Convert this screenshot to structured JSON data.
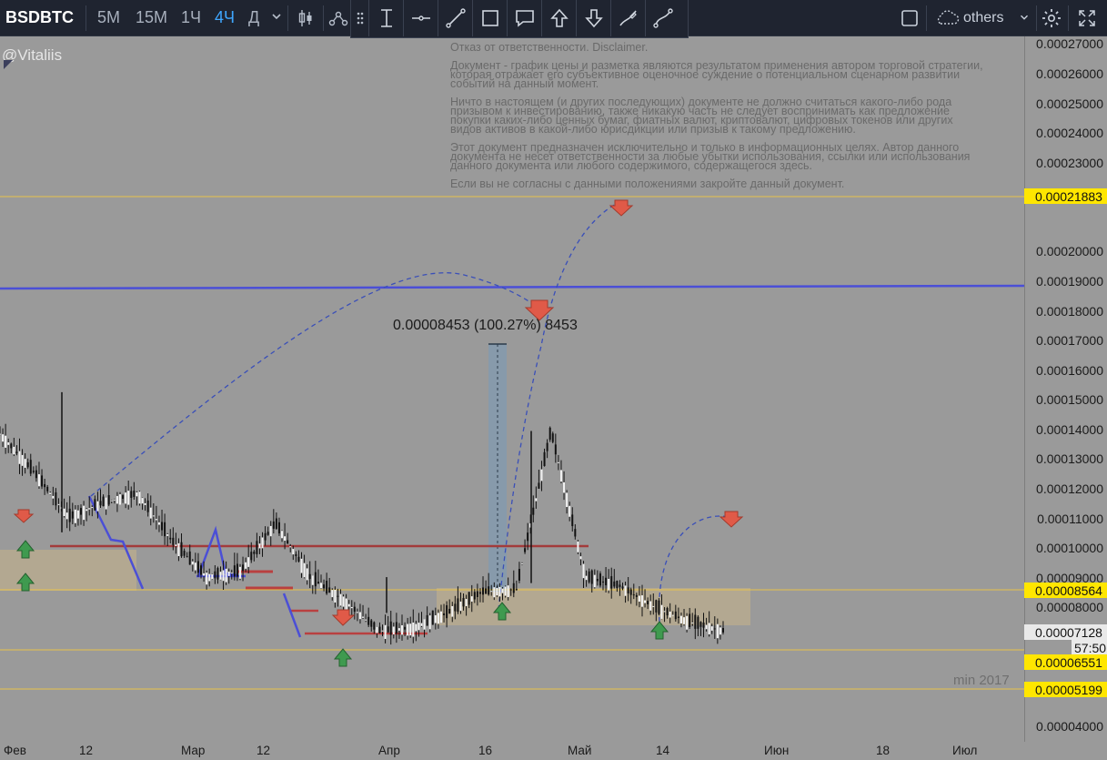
{
  "toolbar": {
    "symbol": "BSDBTC",
    "timeframes": [
      {
        "label": "5M",
        "active": false
      },
      {
        "label": "15M",
        "active": false
      },
      {
        "label": "1Ч",
        "active": false
      },
      {
        "label": "4Ч",
        "active": true
      },
      {
        "label": "Д",
        "active": false
      }
    ],
    "others_label": "others",
    "accent": "#3fa7ff"
  },
  "chart": {
    "author": "@Vitaliis",
    "disclaimer": [
      "Отказ от ответственности. Disclaimer.",
      "Документ - график цены и разметка являются результатом применения автором торговой стратегии, которая отражает его субъективное оценочное суждение о потенциальном сценарном развитии событий на данный момент.",
      "Ничто в настоящем (и других последующих) документе не должно считаться какого-либо рода призывом к инвестированию, также никакую часть не следует воспринимать как предложение покупки каких-либо ценных бумаг, фиатных валют, криптовалют, цифровых токенов или других видов активов в какой-либо юрисдикции или призыв к такому предложению.",
      "Этот документ предназначен исключительно и только в информационных целях. Автор данного документа не несет ответственности за любые убытки использования, ссылки или использования данного документа или любого содержимого, содержащегося здесь.",
      "Если вы не согласны с данными положениями закройте данный документ."
    ],
    "measure_label": "0.00008453 (100.27%) 8453",
    "min_label": "min 2017"
  },
  "price_axis": {
    "ticks": [
      "0.00027000",
      "0.00026000",
      "0.00025000",
      "0.00024000",
      "0.00023000",
      "0.00020000",
      "0.00019000",
      "0.00018000",
      "0.00017000",
      "0.00016000",
      "0.00015000",
      "0.00014000",
      "0.00013000",
      "0.00012000",
      "0.00011000",
      "0.00010000",
      "0.00009000",
      "0.00008000",
      "0.00004000"
    ],
    "badges": {
      "level_high": "0.00021883",
      "level_mid": "0.00008564",
      "current": "0.00007128",
      "timer": "57:50",
      "level_low": "0.00006551",
      "level_min": "0.00005199"
    }
  },
  "time_axis": {
    "ticks": [
      "Фев",
      "12",
      "Мар",
      "12",
      "Апр",
      "16",
      "Май",
      "14",
      "Июн",
      "18",
      "Июл"
    ]
  },
  "chart_data": {
    "type": "candlestick",
    "symbol": "BSDBTC",
    "timeframe": "4Ч",
    "ylim": [
      4e-05,
      0.00027
    ],
    "horizontal_levels": [
      0.00021883,
      8.564e-05,
      6.551e-05,
      5.199e-05
    ],
    "resistance_line": 0.000188,
    "red_level": 0.0001,
    "current_price": 7.128e-05,
    "measurement": {
      "from": 8.453e-05,
      "change_pct": 100.27,
      "to": 0.00016906
    },
    "price_path": [
      [
        "Фев",
        0.000138
      ],
      [
        "Фев",
        0.000125
      ],
      [
        "Фев",
        0.00011
      ],
      [
        "12",
        0.000115
      ],
      [
        "12",
        0.000118
      ],
      [
        "12",
        0.000102
      ],
      [
        "Мар",
        9e-05
      ],
      [
        "Мар",
        9.2e-05
      ],
      [
        "Мар",
        0.000108
      ],
      [
        "12",
        9e-05
      ],
      [
        "12",
        8.2e-05
      ],
      [
        "12",
        7.2e-05
      ],
      [
        "Апр",
        7.3e-05
      ],
      [
        "Апр",
        7.8e-05
      ],
      [
        "Апр",
        8.5e-05
      ],
      [
        "16",
        8.6e-05
      ],
      [
        "16",
        0.000139
      ],
      [
        "16",
        9e-05
      ],
      [
        "Май",
        8.7e-05
      ],
      [
        "Май",
        8e-05
      ],
      [
        "14",
        7.5e-05
      ],
      [
        "14",
        7.2e-05
      ]
    ],
    "grid": false
  }
}
